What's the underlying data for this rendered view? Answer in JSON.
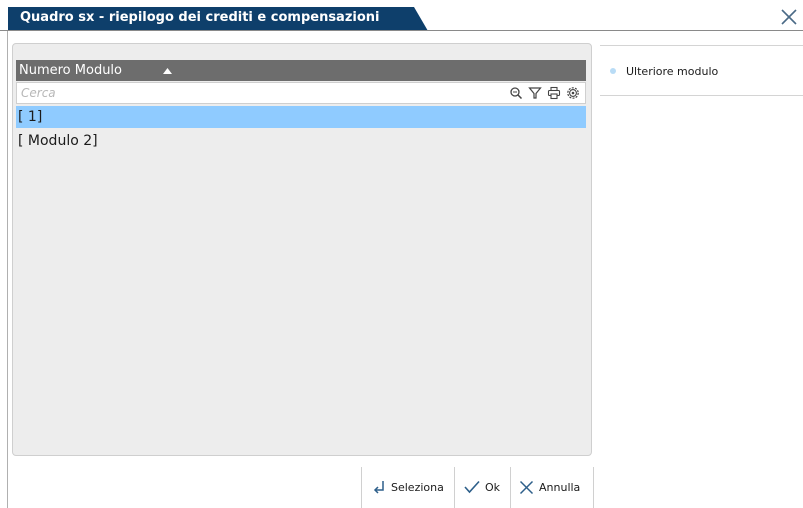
{
  "window": {
    "title": "Quadro sx - riepilogo dei crediti e compensazioni",
    "close_icon": "close-icon"
  },
  "grid": {
    "column_header": "Numero Modulo",
    "sort_direction": "ascending",
    "search": {
      "placeholder": "Cerca",
      "value": ""
    },
    "toolbar_icons": [
      "search-icon",
      "filter-icon",
      "print-icon",
      "settings-icon"
    ],
    "rows": [
      {
        "label": "[ 1]",
        "selected": true
      },
      {
        "label": "[ Modulo 2]",
        "selected": false
      }
    ],
    "selection_color": "#8fcbff",
    "header_color": "#6d6d6d"
  },
  "sidebar": {
    "links": [
      {
        "label": "Ulteriore modulo"
      }
    ]
  },
  "footer": {
    "buttons": [
      {
        "label": "Seleziona",
        "icon": "enter-arrow-icon"
      },
      {
        "label": "Ok",
        "icon": "checkmark-icon"
      },
      {
        "label": "Annulla",
        "icon": "close-icon"
      }
    ]
  },
  "colors": {
    "title_bar": "#0e3f6b",
    "accent": "#8fcbff"
  }
}
